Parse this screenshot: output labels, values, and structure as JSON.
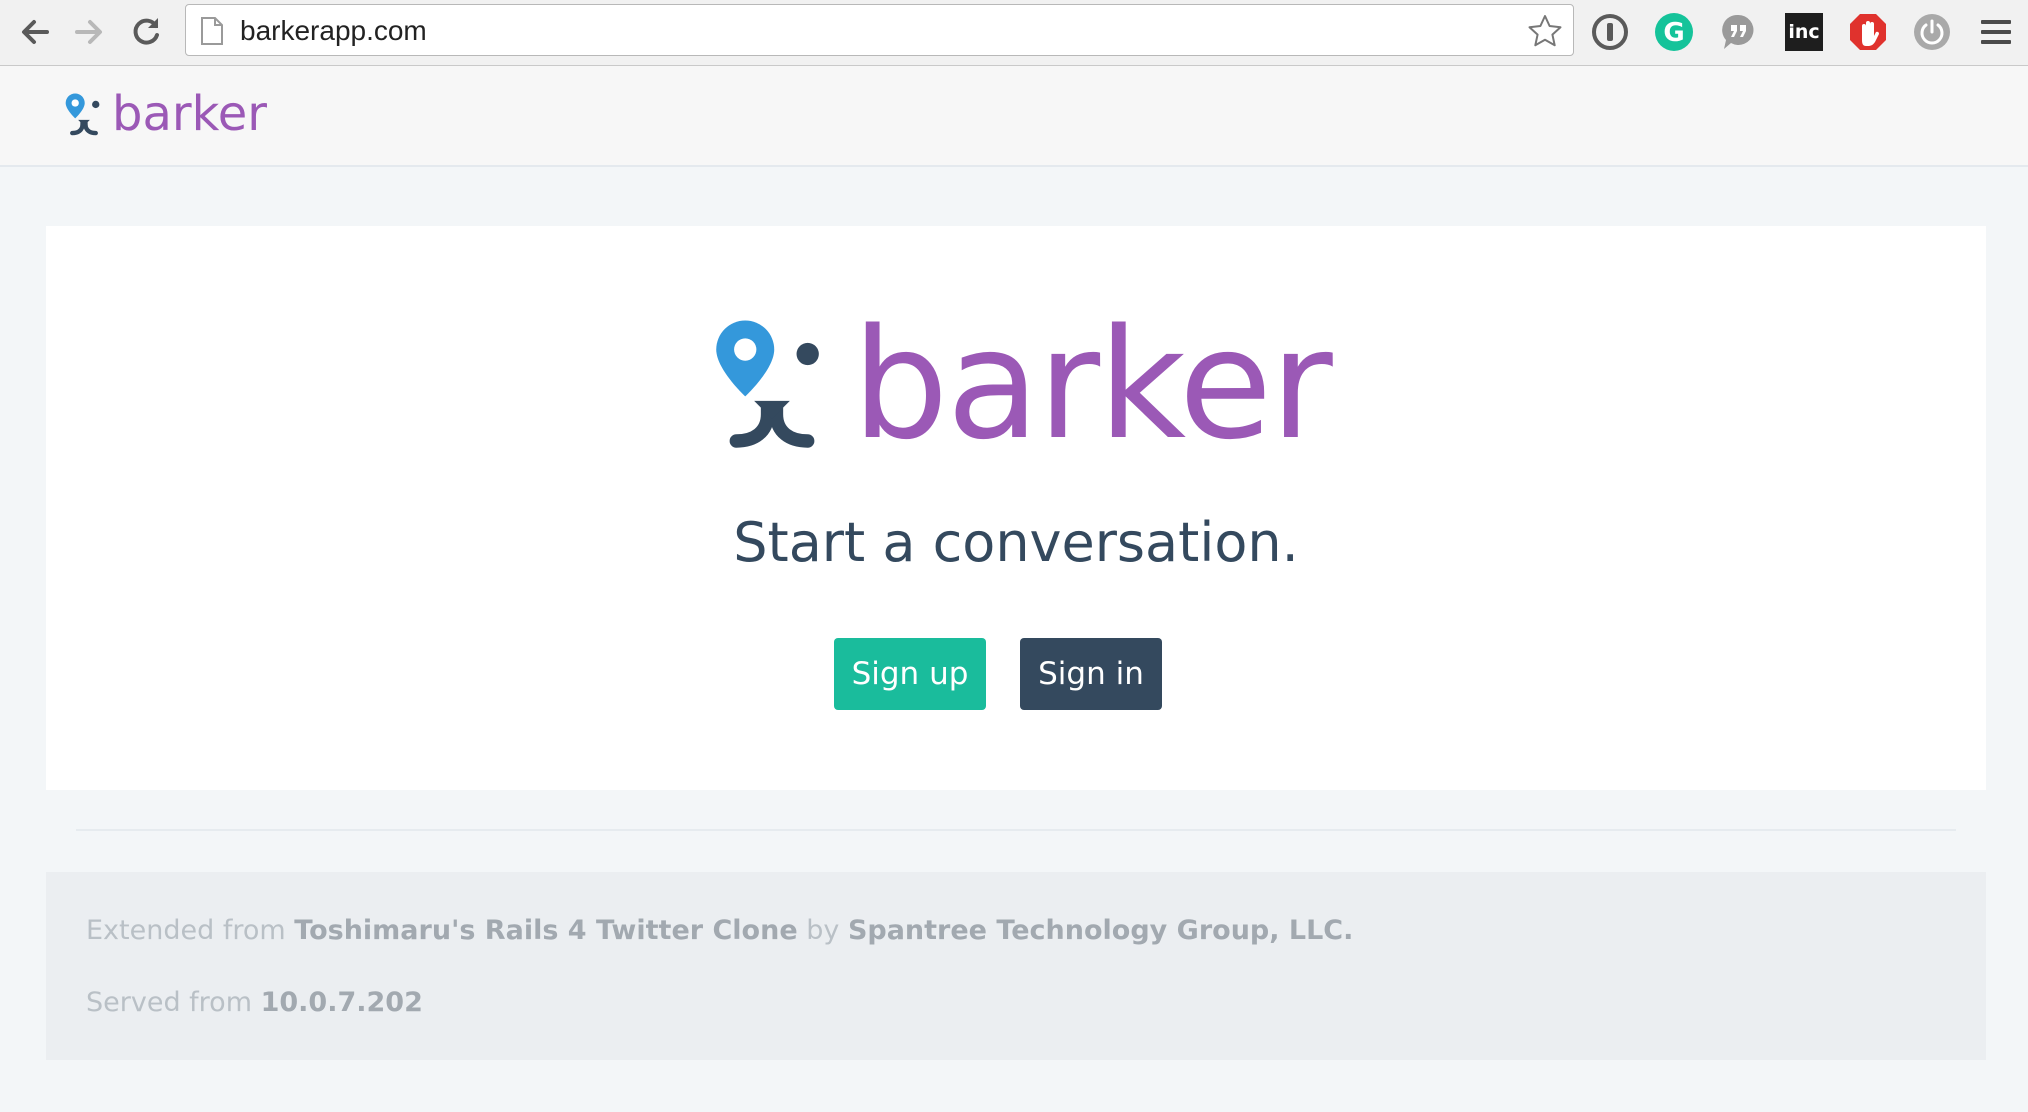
{
  "browser": {
    "url": "barkerapp.com",
    "extensions": [
      "1password-icon",
      "grammarly-icon",
      "quote-icon",
      "inc-icon",
      "adblock-icon",
      "power-icon",
      "menu-icon"
    ],
    "inc_label": "inc",
    "grammarly_letter": "G"
  },
  "navbar": {
    "brand": "barker"
  },
  "hero": {
    "brand": "barker",
    "tagline": "Start a conversation.",
    "signup_label": "Sign up",
    "signin_label": "Sign in"
  },
  "footer": {
    "line1": {
      "prefix": "Extended from ",
      "project": "Toshimaru's Rails 4 Twitter Clone",
      "by": " by ",
      "company": "Spantree Technology Group, LLC."
    },
    "line2": {
      "prefix": "Served from ",
      "ip": "10.0.7.202"
    }
  },
  "colors": {
    "brand_purple": "#9b59b6",
    "pin_blue": "#3498db",
    "dark_navy": "#34495e",
    "teal": "#1abc9c"
  }
}
